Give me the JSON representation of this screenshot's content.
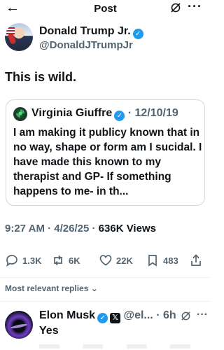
{
  "header": {
    "title": "Post",
    "back_icon": "back-arrow-icon",
    "grok_icon": "grok-icon",
    "more_icon": "more-icon"
  },
  "tweet": {
    "author_name": "Donald Trump Jr.",
    "handle": "@DonaldJTrumpJr",
    "text": "This is wild.",
    "meta_time": "9:27 AM · 4/26/25 · ",
    "views": "636K Views"
  },
  "quote": {
    "author_name": "Virginia Giuffre",
    "date": " · 12/10/19",
    "text": "I am making it publicy known that in no way, shape or form am I sucidal. I have made this known to my therapist and GP- If something happens to me- in th..."
  },
  "actions": {
    "replies": "1.3K",
    "reposts": "6K",
    "likes": "22K",
    "bookmarks": "483"
  },
  "replies_sort": "Most relevant replies",
  "reply": {
    "author_name": "Elon Musk",
    "handle": "@el...",
    "time": " · 6h",
    "text": "Yes"
  },
  "colors": {
    "verified": "#1d9bf0",
    "muted": "#536471",
    "text": "#0f1419"
  }
}
